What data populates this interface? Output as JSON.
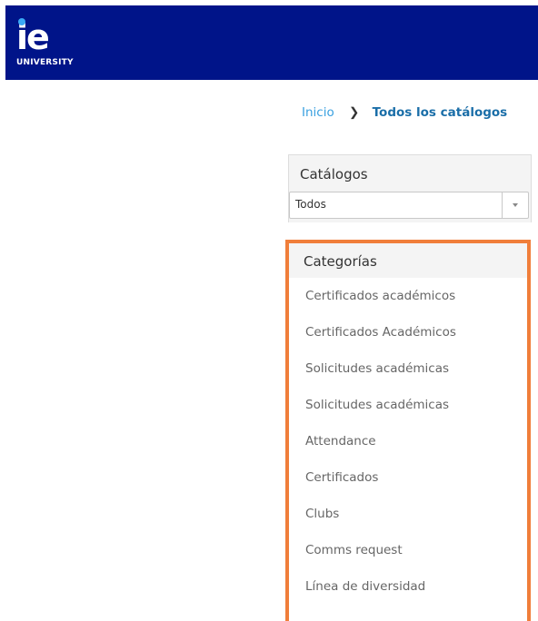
{
  "header": {
    "logo_mark": "ie",
    "logo_text": "UNIVERSITY",
    "background_color": "#001489"
  },
  "breadcrumb": {
    "home": "Inicio",
    "separator": "❯",
    "current": "Todos los catálogos"
  },
  "catalogs": {
    "title": "Catálogos",
    "select_value": "Todos"
  },
  "categories": {
    "title": "Categorías",
    "highlight_color": "#f07e3a",
    "items": [
      "Certificados académicos",
      "Certificados Académicos",
      "Solicitudes académicas",
      "Solicitudes académicas",
      "Attendance",
      "Certificados",
      "Clubs",
      "Comms request",
      "Línea de diversidad"
    ]
  }
}
